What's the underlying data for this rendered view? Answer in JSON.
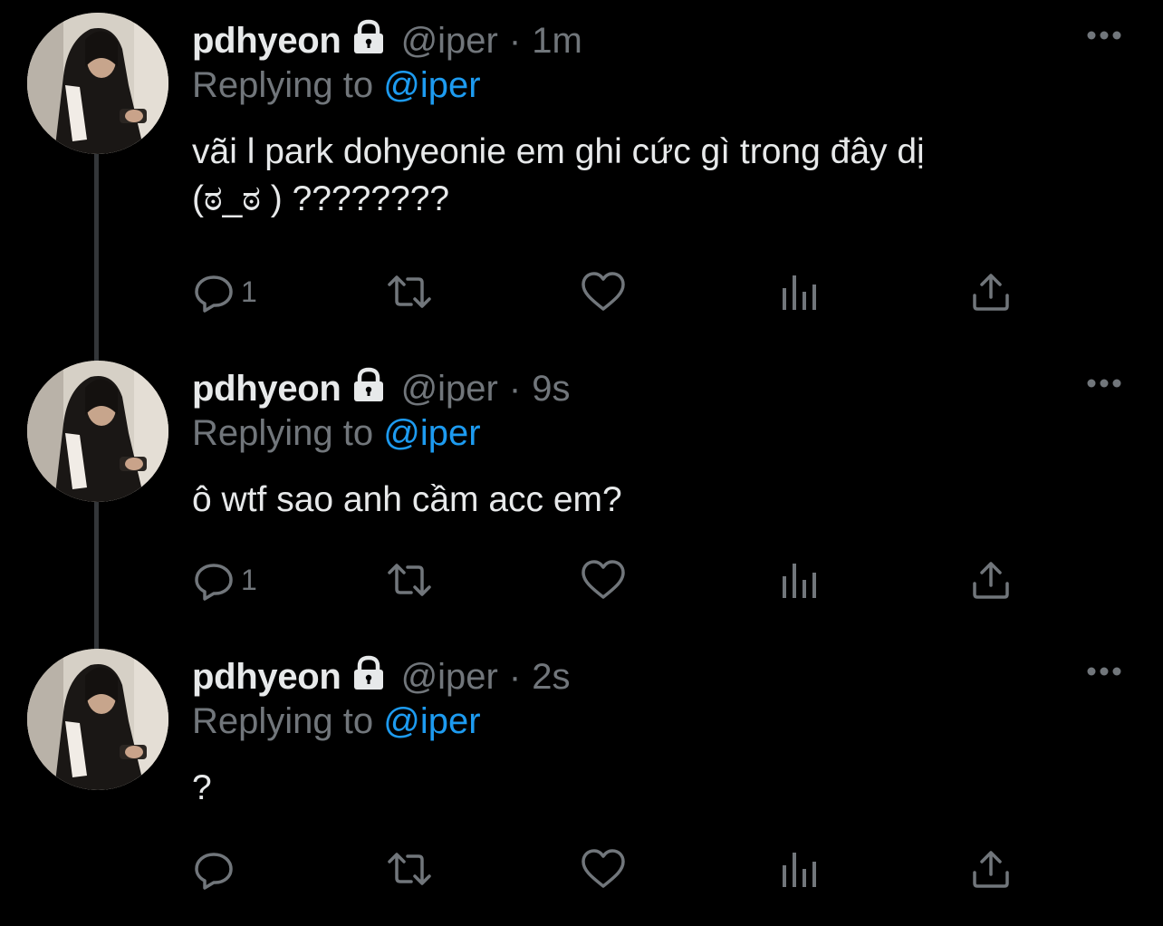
{
  "colors": {
    "background": "#000000",
    "text_primary": "#e7e9ea",
    "text_secondary": "#71767b",
    "accent": "#1d9bf0",
    "thread_line": "#333639"
  },
  "tweets": [
    {
      "display_name": "pdhyeon",
      "protected_icon": "lock-icon",
      "handle": "@iper",
      "separator": "·",
      "time": "1m",
      "replying_label": "Replying to ",
      "replying_to": "@iper",
      "text": "vãi l park dohyeonie em ghi cức gì trong đây dị\n(ಠ_ಠ ) ????????",
      "reply_count": "1",
      "icons": [
        "reply-icon",
        "retweet-icon",
        "like-icon",
        "analytics-icon",
        "share-icon",
        "more-icon"
      ]
    },
    {
      "display_name": "pdhyeon",
      "protected_icon": "lock-icon",
      "handle": "@iper",
      "separator": "·",
      "time": "9s",
      "replying_label": "Replying to ",
      "replying_to": "@iper",
      "text": "ô wtf sao anh cầm acc em?",
      "reply_count": "1",
      "icons": [
        "reply-icon",
        "retweet-icon",
        "like-icon",
        "analytics-icon",
        "share-icon",
        "more-icon"
      ]
    },
    {
      "display_name": "pdhyeon",
      "protected_icon": "lock-icon",
      "handle": "@iper",
      "separator": "·",
      "time": "2s",
      "replying_label": "Replying to ",
      "replying_to": "@iper",
      "text": "?",
      "reply_count": "",
      "icons": [
        "reply-icon",
        "retweet-icon",
        "like-icon",
        "analytics-icon",
        "share-icon",
        "more-icon"
      ]
    }
  ]
}
